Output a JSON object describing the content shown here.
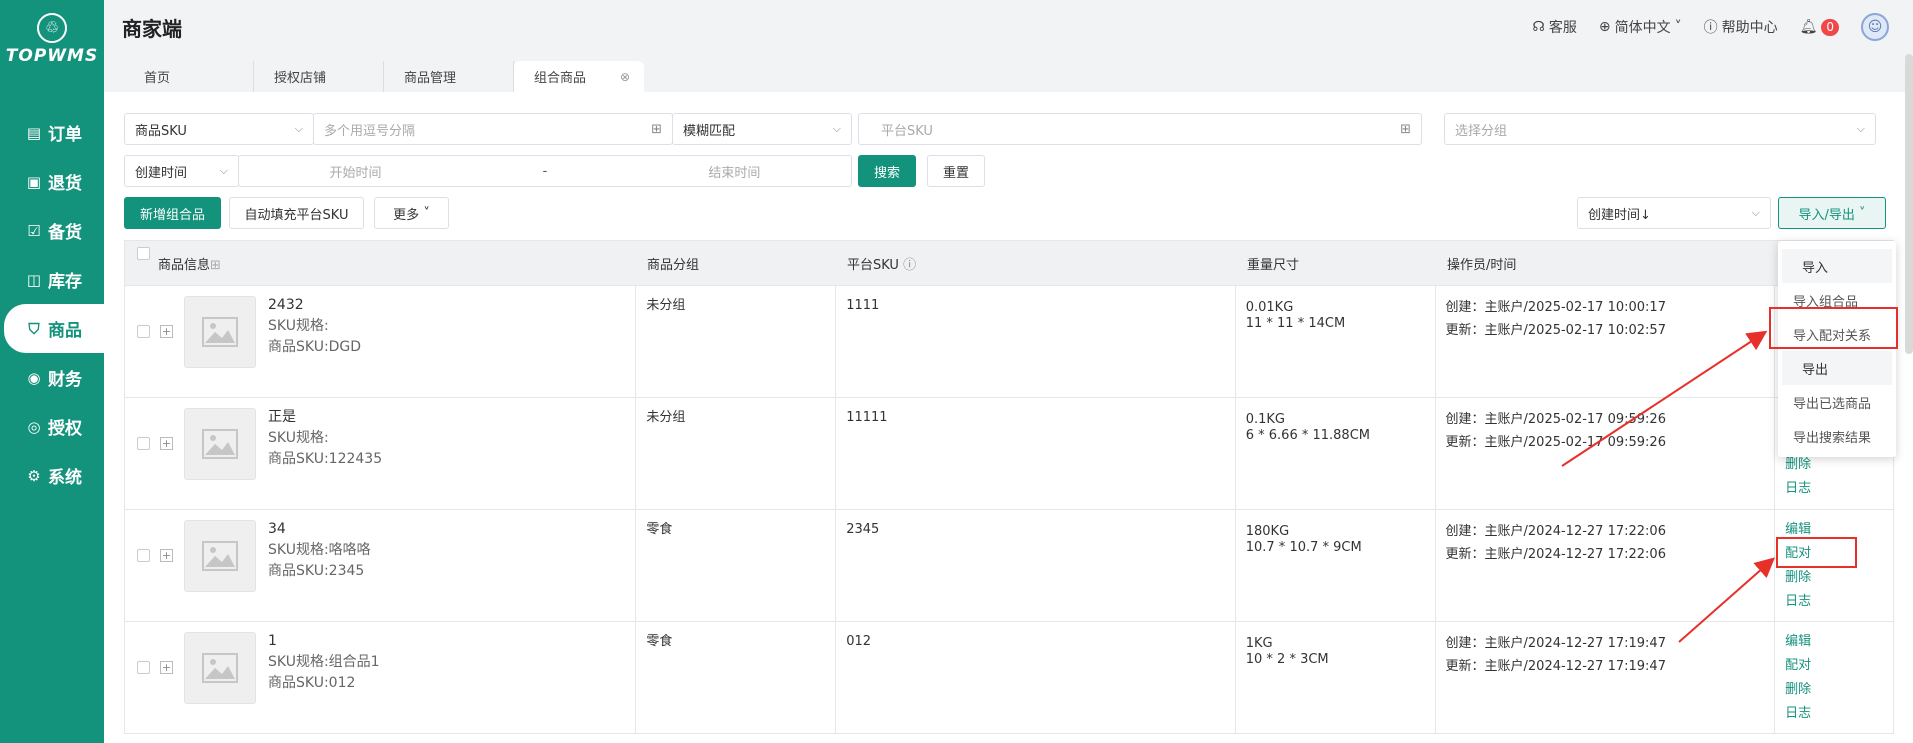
{
  "app": {
    "logo_text": "TOPWMS",
    "title": "商家端"
  },
  "sidebar": [
    {
      "label": "订单",
      "icon": "order-icon"
    },
    {
      "label": "退货",
      "icon": "return-icon"
    },
    {
      "label": "备货",
      "icon": "stock-icon"
    },
    {
      "label": "库存",
      "icon": "inventory-icon"
    },
    {
      "label": "商品",
      "icon": "bag-icon"
    },
    {
      "label": "财务",
      "icon": "finance-icon"
    },
    {
      "label": "授权",
      "icon": "auth-icon"
    },
    {
      "label": "系统",
      "icon": "gear-icon"
    }
  ],
  "header": {
    "service": "客服",
    "language": "简体中文",
    "help": "帮助中心",
    "notify_count": "0"
  },
  "tabs": [
    "首页",
    "授权店铺",
    "商品管理",
    "组合商品"
  ],
  "filters": {
    "sku_select": "商品SKU",
    "sku_placeholder": "多个用逗号分隔",
    "match_select": "模糊匹配",
    "platform_sku_placeholder": "平台SKU",
    "group_placeholder": "选择分组",
    "time_select": "创建时间",
    "start_placeholder": "开始时间",
    "end_placeholder": "结束时间",
    "dash": "-",
    "search": "搜索",
    "reset": "重置"
  },
  "toolbar": {
    "add": "新增组合品",
    "autofill": "自动填充平台SKU",
    "more": "更多",
    "sort": "创建时间↓",
    "import_export": "导入/导出"
  },
  "table": {
    "headers": [
      "商品信息",
      "商品分组",
      "平台SKU",
      "重量尺寸",
      "操作员/时间"
    ],
    "rows": [
      {
        "name": "2432",
        "spec_label": "SKU规格:",
        "spec": "",
        "sku_label": "商品SKU:",
        "sku": "DGD",
        "group": "未分组",
        "platform_sku": "1111",
        "weight": "0.01KG",
        "size": "11 * 11 * 14CM",
        "created": "创建：主账户/2025-02-17 10:00:17",
        "updated": "更新：主账户/2025-02-17 10:02:57",
        "actions": []
      },
      {
        "name": "正是",
        "spec_label": "SKU规格:",
        "spec": "",
        "sku_label": "商品SKU:",
        "sku": "122435",
        "group": "未分组",
        "platform_sku": "11111",
        "weight": "0.1KG",
        "size": "6 * 6.66 * 11.88CM",
        "created": "创建：主账户/2025-02-17 09:59:26",
        "updated": "更新：主账户/2025-02-17 09:59:26",
        "actions": [
          "删除",
          "日志"
        ]
      },
      {
        "name": "34",
        "spec_label": "SKU规格:",
        "spec": "咯咯咯",
        "sku_label": "商品SKU:",
        "sku": "2345",
        "group": "零食",
        "platform_sku": "2345",
        "weight": "180KG",
        "size": "10.7 * 10.7 * 9CM",
        "created": "创建：主账户/2024-12-27 17:22:06",
        "updated": "更新：主账户/2024-12-27 17:22:06",
        "actions": [
          "编辑",
          "配对",
          "删除",
          "日志"
        ]
      },
      {
        "name": "1",
        "spec_label": "SKU规格:",
        "spec": "组合品1",
        "sku_label": "商品SKU:",
        "sku": "012",
        "group": "零食",
        "platform_sku": "012",
        "weight": "1KG",
        "size": "10 * 2 * 3CM",
        "created": "创建：主账户/2024-12-27 17:19:47",
        "updated": "更新：主账户/2024-12-27 17:19:47",
        "actions": [
          "编辑",
          "配对",
          "删除",
          "日志"
        ]
      }
    ]
  },
  "dropdown": {
    "import_head": "导入",
    "import_combo": "导入组合品",
    "import_pairing": "导入配对关系",
    "export_head": "导出",
    "export_selected": "导出已选商品",
    "export_search": "导出搜索结果"
  },
  "colors": {
    "brand": "#13927c",
    "annotation": "#e8302a"
  }
}
